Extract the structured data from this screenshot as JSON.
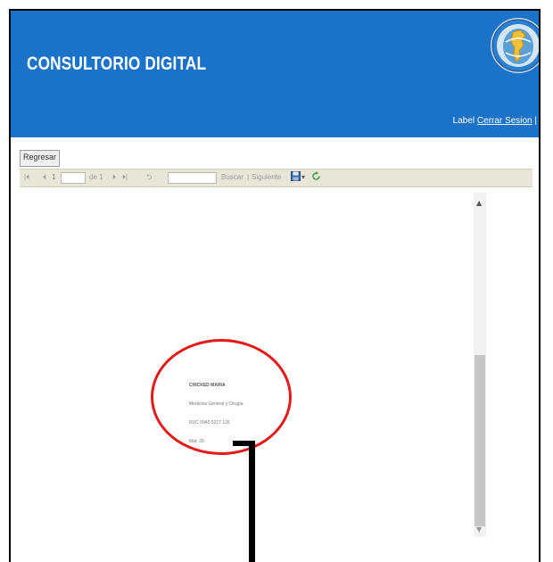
{
  "header": {
    "title": "CONSULTORIO DIGITAL",
    "label_text": "Label",
    "logout_link": "Cerrar Sesion",
    "trailing_text": "|",
    "background_color": "#1a73c8"
  },
  "logo": {
    "icon": "globe-emblem-icon"
  },
  "regresar_button": "Regresar",
  "toolbar": {
    "first_page": "|⏴",
    "prev_page": "⏴",
    "page_value": "1",
    "page_of": "de 1",
    "next_page": "⏵",
    "last_page": "⏵|",
    "back": "⮌",
    "find_value": "",
    "find_label": "Buscar",
    "separator": "|",
    "next_label": "Siguiente",
    "export_icon": "save-disk-icon",
    "export_arrow": "▾",
    "refresh_icon": "refresh-icon",
    "background_color": "#e8e6d9"
  },
  "report": {
    "line1": "CHICKED MARIA",
    "line2": "Medicina General y Cirugía",
    "line3": "RUC 0940 5217 126",
    "line4": "Mat: 20"
  },
  "scrollbar": {
    "up": "▲",
    "down": "▼"
  },
  "annotation": {
    "circle_color": "#e21a1a"
  }
}
